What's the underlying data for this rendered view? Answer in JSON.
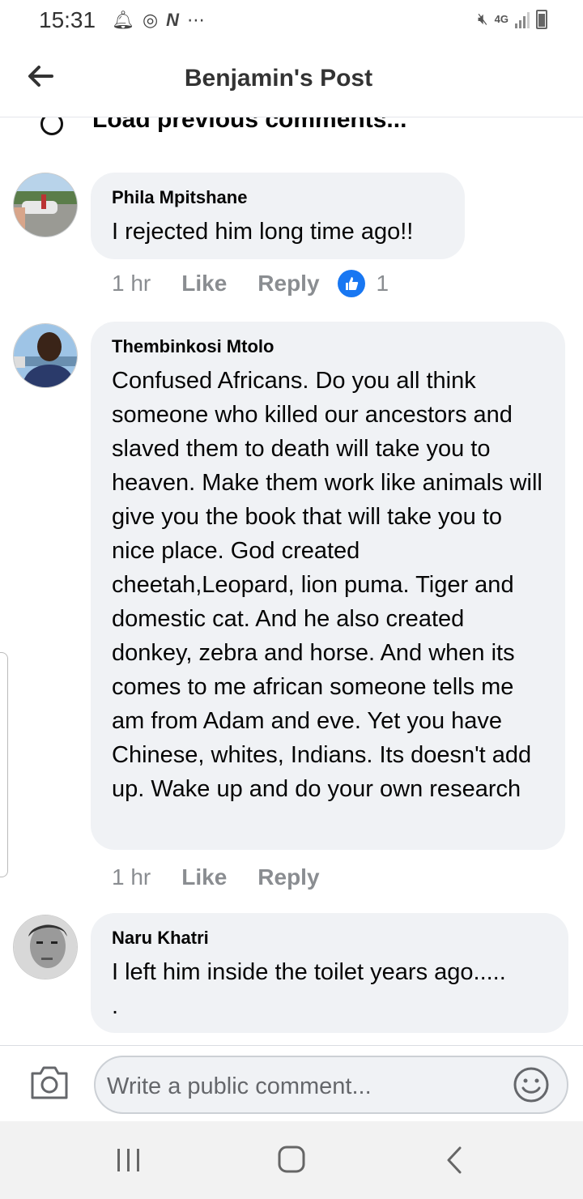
{
  "status_bar": {
    "time": "15:31",
    "network": "4G",
    "left_icons": [
      "notification-icon",
      "chrome-icon",
      "n-app-icon",
      "more-icon"
    ],
    "right_icons": [
      "mute-icon",
      "network-4g-icon",
      "signal-icon",
      "battery-icon"
    ]
  },
  "header": {
    "title": "Benjamin's Post",
    "back_icon": "arrow-left-icon"
  },
  "load_previous": {
    "label": "Load previous comments..."
  },
  "comments": [
    {
      "author": "Phila Mpitshane",
      "text": "I rejected him long time ago!!",
      "time": "1 hr",
      "like_label": "Like",
      "reply_label": "Reply",
      "reaction_count": "1"
    },
    {
      "author": "Thembinkosi Mtolo",
      "text": "Confused Africans. Do you all think someone who killed our ancestors and slaved them to death will take you to heaven. Make them work like animals will give you the book that will take you to nice place. God created cheetah,Leopard, lion puma. Tiger and domestic cat. And he also created donkey, zebra and horse. And when its comes to me african someone tells me am from Adam and eve. Yet you have Chinese, whites, Indians. Its doesn't add up. Wake up and do your own research",
      "time": "1 hr",
      "like_label": "Like",
      "reply_label": "Reply"
    },
    {
      "author": "Naru Khatri",
      "text": "I left him inside the toilet years ago.....\n.",
      "time": "",
      "like_label": "",
      "reply_label": ""
    }
  ],
  "composer": {
    "placeholder": "Write a public comment...",
    "camera_icon": "camera-icon",
    "emoji_icon": "smiley-icon"
  },
  "colors": {
    "bubble_bg": "#f0f2f5",
    "meta_text": "#8a8d91",
    "like_blue": "#1877f2",
    "navbar_bg": "#f2f2f2"
  }
}
